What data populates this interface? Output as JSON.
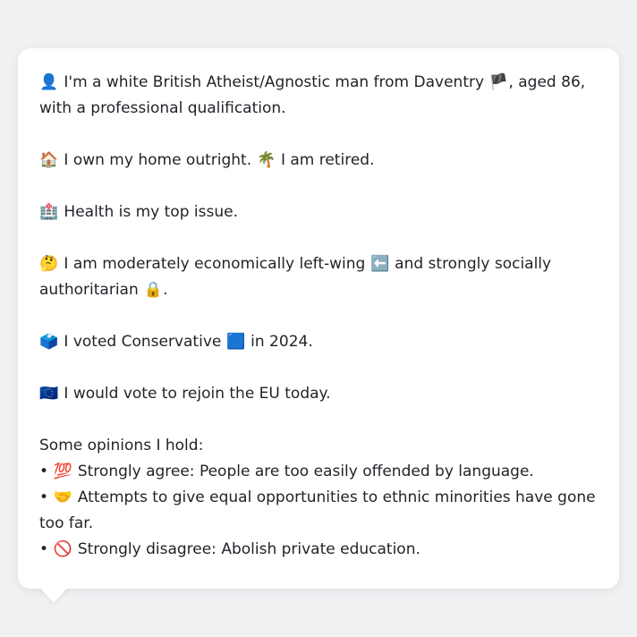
{
  "intro": {
    "icon": "👤",
    "text_a": "I'm a white British Atheist/Agnostic man from Daventry",
    "flag": "🏴",
    "text_b": ", aged 86, with a professional qualification."
  },
  "home": {
    "icon": "🏠",
    "text_a": "I own my home outright.",
    "palm_icon": "🌴",
    "text_b": "I am retired."
  },
  "health": {
    "icon": "🏥",
    "text": "Health is my top issue."
  },
  "politics": {
    "icon": "🤔",
    "text_a": "I am moderately economically left-wing",
    "left_icon": "⬅️",
    "text_b": "and strongly socially authoritarian",
    "lock_icon": "🔒",
    "text_c": "."
  },
  "vote": {
    "icon": "🗳️",
    "text_a": "I voted Conservative",
    "square_icon": "🟦",
    "text_b": "in 2024."
  },
  "eu": {
    "icon": "🇪🇺",
    "text": "I would vote to rejoin the EU today."
  },
  "opinions": {
    "heading": "Some opinions I hold:",
    "items": [
      {
        "bullet": "•",
        "icon": "💯",
        "text": "Strongly agree: People are too easily offended by language."
      },
      {
        "bullet": "•",
        "icon": "🤝",
        "text": "Attempts to give equal opportunities to ethnic minorities have gone too far."
      },
      {
        "bullet": "•",
        "icon": "🚫",
        "text": "Strongly disagree: Abolish private education."
      }
    ]
  }
}
